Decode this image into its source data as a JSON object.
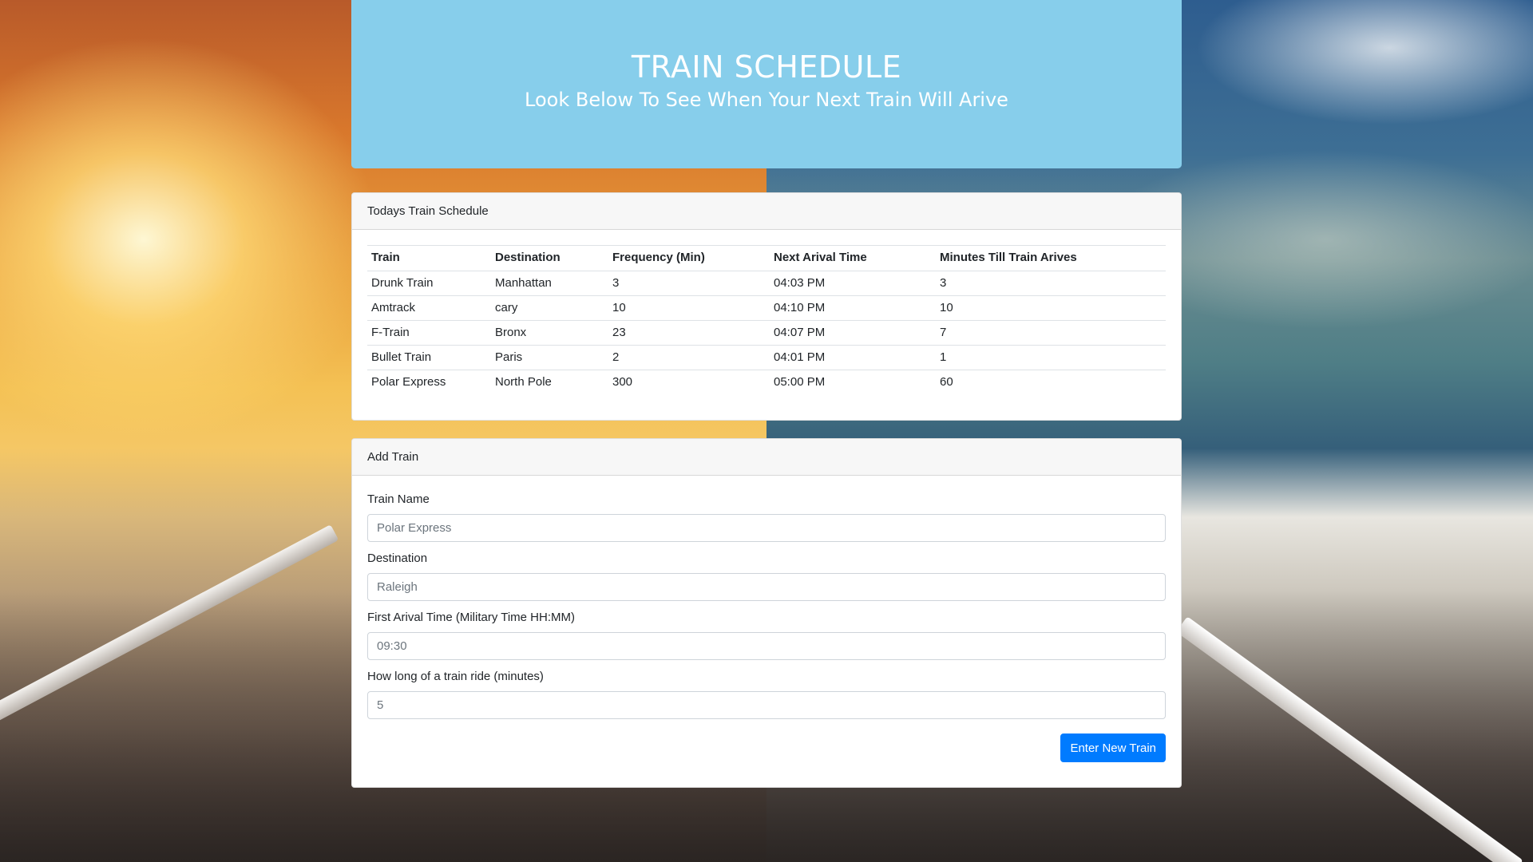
{
  "header": {
    "title": "TRAIN SCHEDULE",
    "subtitle": "Look Below To See When Your Next Train Will Arive"
  },
  "schedule": {
    "heading": "Todays Train Schedule",
    "columns": [
      "Train",
      "Destination",
      "Frequency (Min)",
      "Next Arival Time",
      "Minutes Till Train Arives"
    ],
    "rows": [
      [
        "Drunk Train",
        "Manhattan",
        "3",
        "04:03 PM",
        "3"
      ],
      [
        "Amtrack",
        "cary",
        "10",
        "04:10 PM",
        "10"
      ],
      [
        "F-Train",
        "Bronx",
        "23",
        "04:07 PM",
        "7"
      ],
      [
        "Bullet Train",
        "Paris",
        "2",
        "04:01 PM",
        "1"
      ],
      [
        "Polar Express",
        "North Pole",
        "300",
        "05:00 PM",
        "60"
      ]
    ]
  },
  "add_train": {
    "heading": "Add Train",
    "fields": [
      {
        "label": "Train Name",
        "placeholder": "Polar Express"
      },
      {
        "label": "Destination",
        "placeholder": "Raleigh"
      },
      {
        "label": "First Arival Time (Military Time HH:MM)",
        "placeholder": "09:30"
      },
      {
        "label": "How long of a train ride (minutes)",
        "placeholder": "5"
      }
    ],
    "submit_label": "Enter New Train"
  },
  "colors": {
    "jumbotron": "#87ceeb",
    "primary": "#007bff"
  }
}
